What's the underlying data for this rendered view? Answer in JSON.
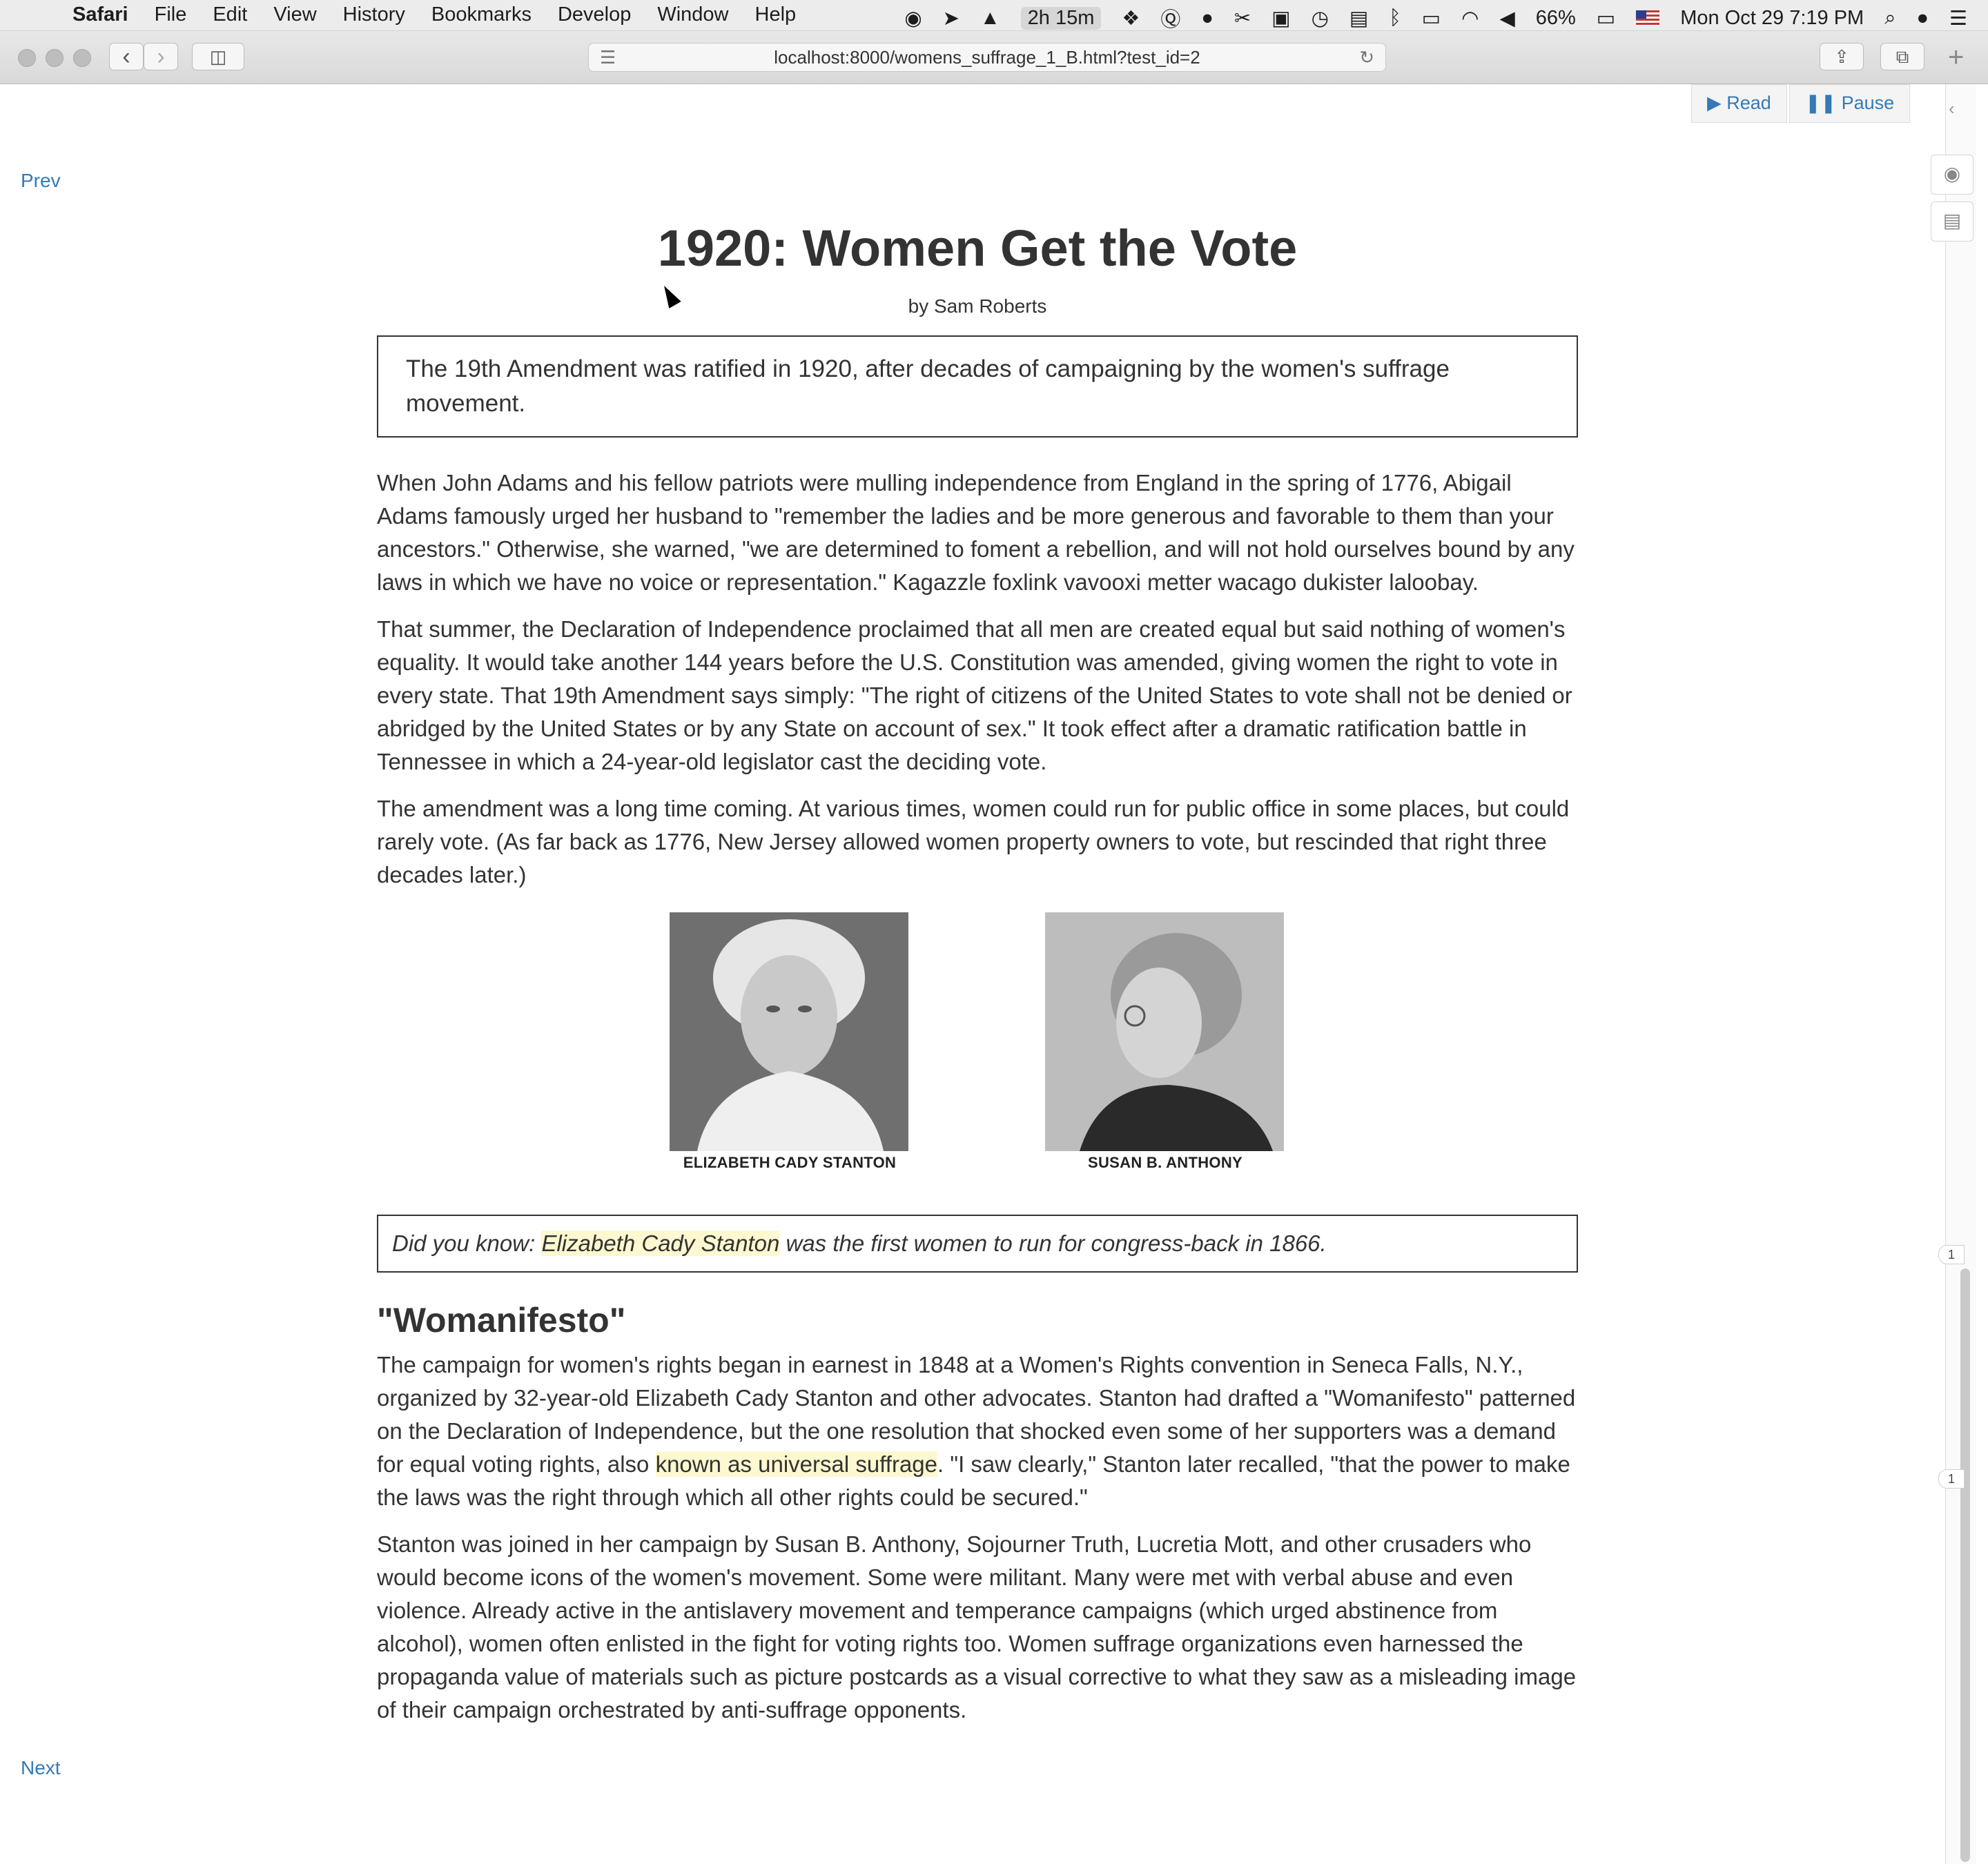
{
  "menubar": {
    "app": "Safari",
    "menus": [
      "File",
      "Edit",
      "View",
      "History",
      "Bookmarks",
      "Develop",
      "Window",
      "Help"
    ],
    "timer": "2h 15m",
    "battery": "66%",
    "datetime": "Mon Oct 29  7:19 PM"
  },
  "browser": {
    "url": "localhost:8000/womens_suffrage_1_B.html?test_id=2"
  },
  "controls": {
    "read_label": "Read",
    "pause_label": "Pause",
    "prev_label": "Prev",
    "next_label": "Next"
  },
  "article": {
    "title": "1920: Women Get the Vote",
    "byline": "by Sam Roberts",
    "summary": "The 19th Amendment was ratified in 1920, after decades of campaigning by the women's suffrage movement.",
    "paragraphs": [
      "When John Adams and his fellow patriots were mulling independence from England in the spring of 1776, Abigail Adams famously urged her husband to \"remember the ladies and be more generous and favorable to them than your ancestors.\" Otherwise, she warned, \"we are determined to foment a rebellion, and will not hold ourselves bound by any laws in which we have no voice or representation.\" Kagazzle foxlink vavooxi metter wacago dukister laloobay.",
      "That summer, the Declaration of Independence proclaimed that all men are created equal but said nothing of women's equality. It would take another 144 years before the U.S. Constitution was amended, giving women the right to vote in every state. That 19th Amendment says simply: \"The right of citizens of the United States to vote shall not be denied or abridged by the United States or by any State on account of sex.\" It took effect after a dramatic ratification battle in Tennessee in which a 24-year-old legislator cast the deciding vote.",
      "The amendment was a long time coming. At various times, women could run for public office in some places, but could rarely vote. (As far back as 1776, New Jersey allowed women property owners to vote, but rescinded that right three decades later.)"
    ],
    "figures": [
      {
        "caption": "ELIZABETH CADY STANTON"
      },
      {
        "caption": "SUSAN B. ANTHONY"
      }
    ],
    "did_you_know": {
      "prefix": "Did you know: ",
      "highlight": "Elizabeth Cady Stanton",
      "suffix": " was the first women to run for congress-back in 1866."
    },
    "section_heading": "\"Womanifesto\"",
    "section_p1": {
      "before": "The campaign for women's rights began in earnest in 1848 at a Women's Rights convention in Seneca Falls, N.Y., organized by 32-year-old Elizabeth Cady Stanton and other advocates. Stanton had drafted a \"Womanifesto\" patterned on the Declaration of Independence, but the one resolution that shocked even some of her supporters was a demand for equal voting rights, also ",
      "highlight": "known as universal suffrage",
      "after": ". \"I saw clearly,\" Stanton later recalled, \"that the power to make the laws was the right through which all other rights could be secured.\""
    },
    "section_p2": "Stanton was joined in her campaign by Susan B. Anthony, Sojourner Truth, Lucretia Mott, and other crusaders who would become icons of the women's movement. Some were militant. Many were met with verbal abuse and even violence. Already active in the antislavery movement and temperance campaigns (which urged abstinence from alcohol), women often enlisted in the fight for voting rights too. Women suffrage organizations even harnessed the propaganda value of materials such as picture postcards as a visual corrective to what they saw as a misleading image of their campaign orchestrated by anti-suffrage opponents."
  },
  "markers": [
    "1",
    "1"
  ]
}
